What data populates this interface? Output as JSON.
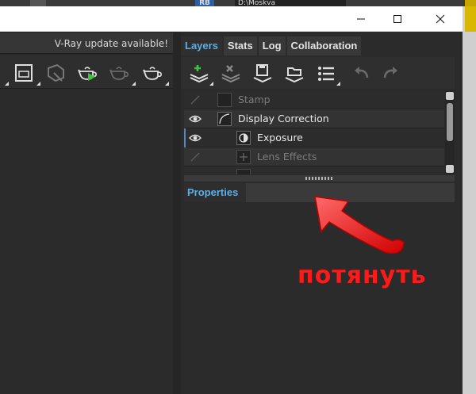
{
  "topbar": {
    "rb_label": "RB",
    "path_label": "D:\\Moskva"
  },
  "window": {
    "minimize_glyph": "—",
    "maximize_glyph": "☐",
    "close_glyph": "✕"
  },
  "left": {
    "vray_notice": "V-Ray update available!",
    "toolbar_icons": [
      "frame-icon",
      "render-region-icon",
      "teapot-render-icon",
      "teapot-render-interactive-icon",
      "teapot-render-disabled-icon",
      "teapot-icon"
    ]
  },
  "tabs": [
    {
      "label": "Layers",
      "active": true
    },
    {
      "label": "Stats",
      "active": false
    },
    {
      "label": "Log",
      "active": false
    },
    {
      "label": "Collaboration",
      "active": false
    }
  ],
  "layer_toolbar": [
    "add-layer-icon",
    "remove-layer-icon",
    "save-layer-icon",
    "load-layer-icon",
    "list-icon",
    "undo-icon",
    "redo-icon"
  ],
  "layers": [
    {
      "name": "Stamp",
      "visible": false
    },
    {
      "name": "Display Correction",
      "visible": true
    },
    {
      "name": "Exposure",
      "visible": true
    },
    {
      "name": "Lens Effects",
      "visible": false
    }
  ],
  "properties": {
    "title": "Properties"
  },
  "annotation": {
    "text": "потянуть",
    "color": "#ff1a1a"
  },
  "colors": {
    "accent": "#5ab0e8",
    "panel": "#2b2b2b"
  }
}
